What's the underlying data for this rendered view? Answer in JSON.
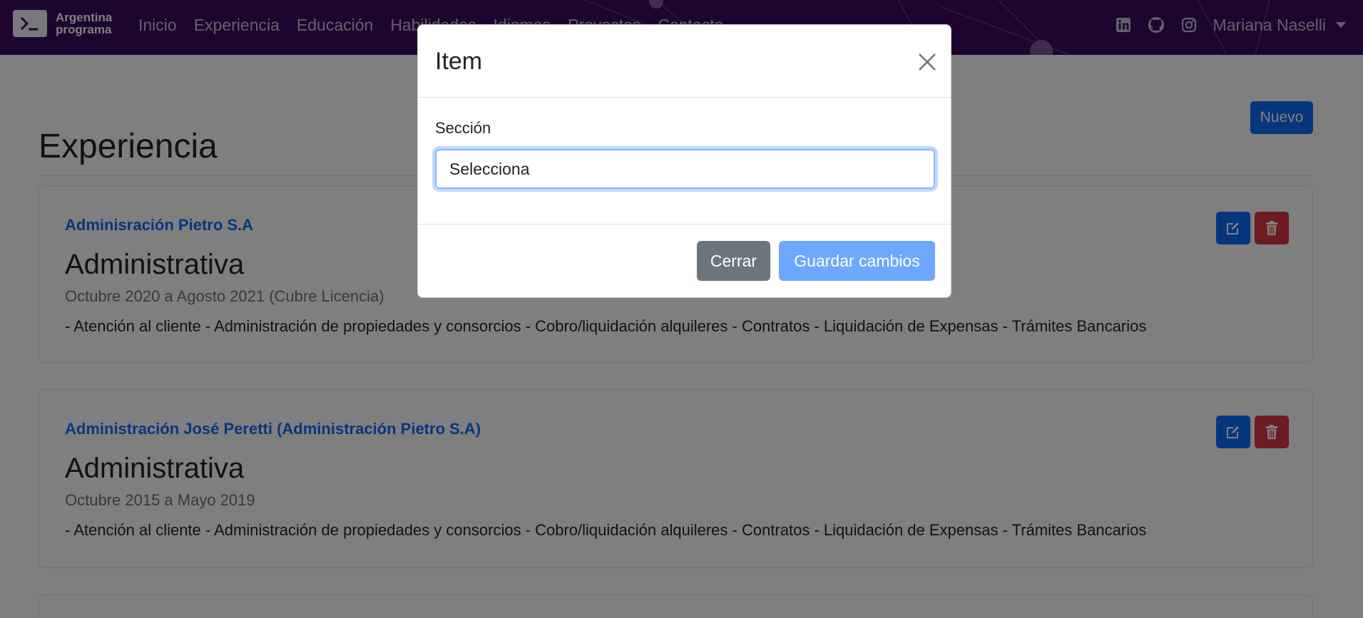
{
  "navbar": {
    "brand_line1": "Argentina",
    "brand_line2": "programa",
    "links": [
      "Inicio",
      "Experiencia",
      "Educación",
      "Habilidades",
      "Idiomas",
      "Proyectos",
      "Contacto"
    ],
    "user_name": "Mariana Naselli",
    "icons": [
      "linkedin-icon",
      "github-icon",
      "instagram-icon"
    ]
  },
  "main": {
    "section_title": "Experiencia",
    "new_button": "Nuevo",
    "items": [
      {
        "company": "Adminisración Pietro S.A",
        "role": "Administrativa",
        "dates": "Octubre 2020 a Agosto 2021 (Cubre Licencia)",
        "description": "- Atención al cliente - Administración de propiedades y consorcios - Cobro/liquidación alquileres - Contratos - Liquidación de Expensas - Trámites Bancarios"
      },
      {
        "company": "Administración José Peretti (Administración Pietro S.A)",
        "role": "Administrativa",
        "dates": "Octubre 2015 a Mayo 2019",
        "description": "- Atención al cliente - Administración de propiedades y consorcios - Cobro/liquidación alquileres - Contratos - Liquidación de Expensas - Trámites Bancarios"
      }
    ]
  },
  "modal": {
    "title": "Item",
    "field_label": "Sección",
    "select_value": "Selecciona",
    "close_button": "Cerrar",
    "save_button": "Guardar cambios"
  },
  "colors": {
    "navbar": "#3b0a5e",
    "primary": "#0d6efd",
    "danger": "#dc3545",
    "secondary": "#6c757d",
    "primary_disabled": "#6ea8fe"
  }
}
